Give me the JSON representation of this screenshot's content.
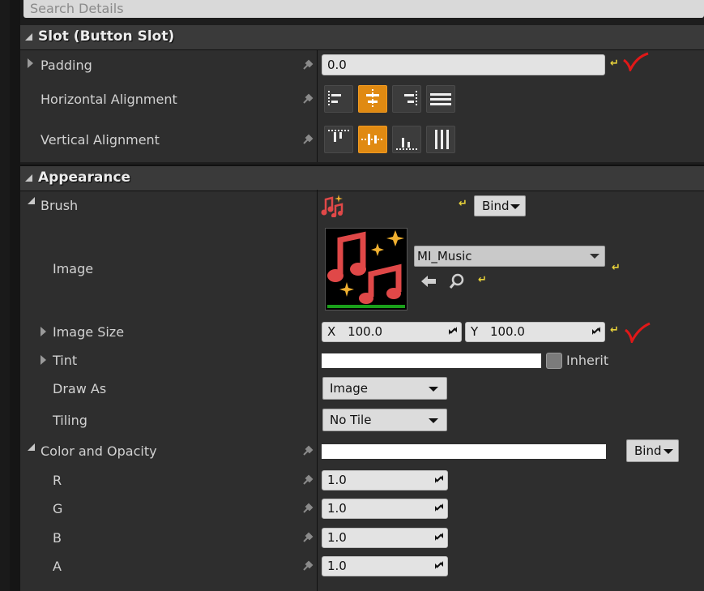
{
  "search": {
    "placeholder": "Search Details"
  },
  "sections": {
    "slot": {
      "title": "Slot (Button Slot)",
      "padding": {
        "label": "Padding",
        "value": "0.0"
      },
      "horizontal_alignment": {
        "label": "Horizontal Alignment",
        "selected": "center"
      },
      "vertical_alignment": {
        "label": "Vertical Alignment",
        "selected": "center"
      }
    },
    "appearance": {
      "title": "Appearance",
      "brush": {
        "label": "Brush",
        "bind_label": "Bind"
      },
      "image": {
        "label": "Image",
        "asset": "MI_Music"
      },
      "image_size": {
        "label": "Image Size",
        "x_prefix": "X",
        "x_value": "100.0",
        "y_prefix": "Y",
        "y_value": "100.0"
      },
      "tint": {
        "label": "Tint",
        "inherit_label": "Inherit"
      },
      "draw_as": {
        "label": "Draw As",
        "value": "Image"
      },
      "tiling": {
        "label": "Tiling",
        "value": "No Tile"
      },
      "color_opacity": {
        "label": "Color and Opacity",
        "bind_label": "Bind",
        "channels": [
          {
            "label": "R",
            "value": "1.0"
          },
          {
            "label": "G",
            "value": "1.0"
          },
          {
            "label": "B",
            "value": "1.0"
          },
          {
            "label": "A",
            "value": "1.0"
          }
        ]
      }
    }
  },
  "colors": {
    "accent_orange": "#e08a12",
    "reset_yellow": "#e8d23a",
    "checkmark_red": "#e01818"
  },
  "icons": [
    "key-icon",
    "reset-arrow-icon",
    "checkmark-icon",
    "music-notes-icon",
    "back-arrow-icon",
    "search-icon",
    "spin-icon",
    "caret-down-icon"
  ]
}
